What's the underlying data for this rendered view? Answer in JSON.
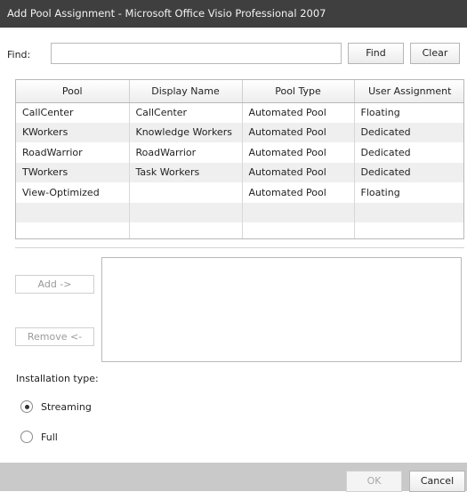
{
  "window": {
    "title": "Add Pool Assignment - Microsoft Office Visio Professional 2007"
  },
  "search": {
    "label": "Find:",
    "value": "",
    "placeholder": "",
    "find_button": "Find",
    "clear_button": "Clear"
  },
  "table": {
    "columns": [
      "Pool",
      "Display Name",
      "Pool Type",
      "User Assignment"
    ],
    "rows": [
      [
        "CallCenter",
        "CallCenter",
        "Automated Pool",
        "Floating"
      ],
      [
        "KWorkers",
        "Knowledge Workers",
        "Automated Pool",
        "Dedicated"
      ],
      [
        "RoadWarrior",
        "RoadWarrior",
        "Automated Pool",
        "Dedicated"
      ],
      [
        "TWorkers",
        "Task Workers",
        "Automated Pool",
        "Dedicated"
      ],
      [
        "View-Optimized",
        "",
        "Automated Pool",
        "Floating"
      ],
      [
        "",
        "",
        "",
        ""
      ],
      [
        "",
        "",
        "",
        ""
      ]
    ]
  },
  "assign": {
    "add_button": "Add ->",
    "remove_button": "Remove <-",
    "items": []
  },
  "installation": {
    "label": "Installation type:",
    "options": [
      {
        "label": "Streaming",
        "selected": true
      },
      {
        "label": "Full",
        "selected": false
      }
    ]
  },
  "footer": {
    "ok_button": "OK",
    "cancel_button": "Cancel"
  },
  "colors": {
    "titlebar": "#3f3f3f",
    "footer": "#c9c9c9",
    "row_alt": "#efefef"
  }
}
